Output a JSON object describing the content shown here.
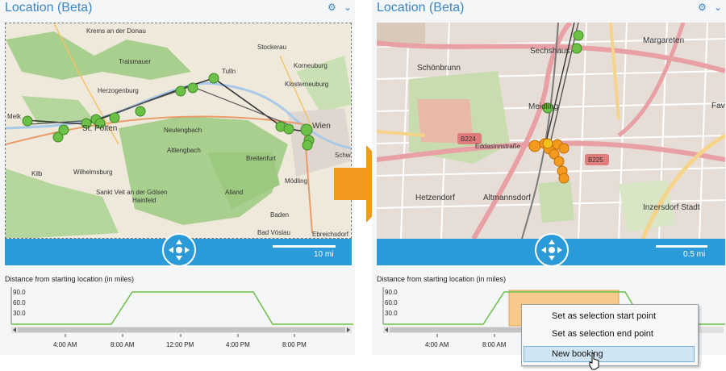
{
  "left_panel": {
    "title": "Location (Beta)",
    "gear_icon": "gear-icon",
    "chevron_icon": "chevron-down-icon",
    "map_labels": [
      "Krems an der Donau",
      "Stockerau",
      "Korneuburg",
      "Traismauer",
      "Tulln",
      "Klosterneuburg",
      "Herzogenburg",
      "Melk",
      "St. Pölten",
      "Neulengbach",
      "Wien",
      "Altlengbach",
      "Breitenfurt",
      "Schwe",
      "Kilb",
      "Wilhelmsburg",
      "Mödling",
      "Sankt Veit an der Gölsen",
      "Hainfeld",
      "Alland",
      "Baden",
      "Bad Vöslau",
      "Ebreichsdorf"
    ],
    "scale_label": "10 mi",
    "distance_label": "Distance from starting location (in miles)",
    "y_ticks": [
      "90.0",
      "60.0",
      "30.0"
    ],
    "x_ticks": [
      "4:00 AM",
      "8:00 AM",
      "12:00 PM",
      "4:00 PM",
      "8:00 PM"
    ]
  },
  "right_panel": {
    "title": "Location (Beta)",
    "gear_icon": "gear-icon",
    "chevron_icon": "chevron-down-icon",
    "map_labels": [
      "Sechshaus",
      "Margareten",
      "Schönbrunn",
      "Meidling",
      "Fav",
      "B224",
      "Eddasinnstraße",
      "B225",
      "Hetzendorf",
      "Altmannsdorf",
      "Inzersdorf Stadt"
    ],
    "scale_label": "0.5 mi",
    "distance_label": "Distance from starting location (in miles)",
    "y_ticks": [
      "90.0",
      "60.0",
      "30.0"
    ],
    "x_ticks": [
      "4:00 AM",
      "8:00 AM"
    ]
  },
  "context_menu": {
    "items": [
      "Set as selection start point",
      "Set as selection end point",
      "New booking"
    ],
    "highlighted": "New booking"
  },
  "colors": {
    "accent": "#2a9bd8",
    "title": "#3c86c6",
    "marker_green": "#6cbf47",
    "marker_orange": "#f39a1e",
    "selection": "#f7c98a",
    "arrow": "#f39a1e"
  }
}
